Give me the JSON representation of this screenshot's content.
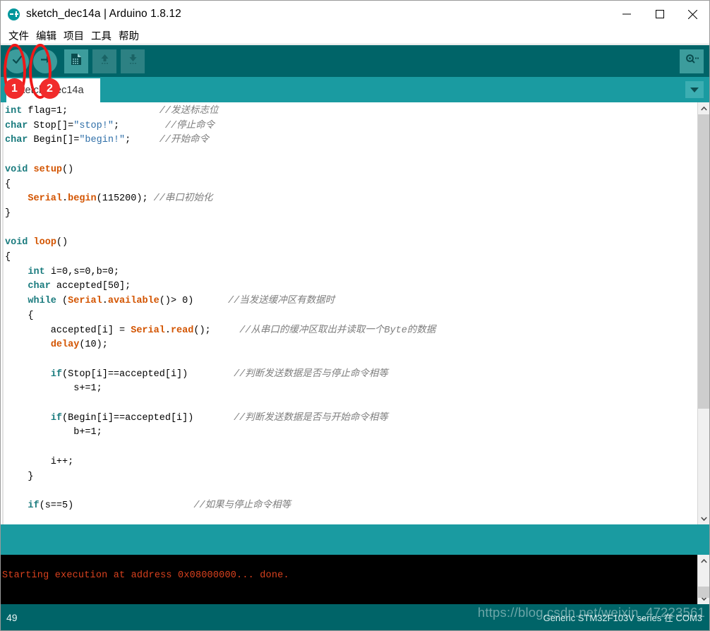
{
  "window": {
    "title": "sketch_dec14a | Arduino 1.8.12",
    "logo_icon": "arduino-logo-icon",
    "minimize_icon": "minimize-icon",
    "maximize_icon": "maximize-icon",
    "close_icon": "close-icon"
  },
  "menubar": {
    "items": [
      {
        "label": "文件",
        "name": "menu-file"
      },
      {
        "label": "编辑",
        "name": "menu-edit"
      },
      {
        "label": "项目",
        "name": "menu-sketch"
      },
      {
        "label": "工具",
        "name": "menu-tools"
      },
      {
        "label": "帮助",
        "name": "menu-help"
      }
    ]
  },
  "toolbar": {
    "verify_icon": "checkmark-icon",
    "upload_icon": "arrow-right-icon",
    "new_icon": "new-document-icon",
    "open_icon": "arrow-up-icon",
    "save_icon": "arrow-down-icon",
    "serial_monitor_icon": "magnifier-icon",
    "background_color": "#006468"
  },
  "tabbar": {
    "active_tab_label": "sketch_dec14a",
    "menu_icon": "chevron-down-icon",
    "background_color": "#1a9ba1"
  },
  "editor": {
    "lines": [
      {
        "segments": [
          {
            "t": "int",
            "c": "kw"
          },
          {
            "t": " flag=1;",
            "c": "id"
          },
          {
            "t": "                ",
            "c": "id"
          },
          {
            "t": "//发送标志位",
            "c": "cmt"
          }
        ]
      },
      {
        "segments": [
          {
            "t": "char",
            "c": "kw"
          },
          {
            "t": " Stop[]=",
            "c": "id"
          },
          {
            "t": "\"stop!\"",
            "c": "lit"
          },
          {
            "t": ";",
            "c": "id"
          },
          {
            "t": "        ",
            "c": "id"
          },
          {
            "t": "//停止命令",
            "c": "cmt"
          }
        ]
      },
      {
        "segments": [
          {
            "t": "char",
            "c": "kw"
          },
          {
            "t": " Begin[]=",
            "c": "id"
          },
          {
            "t": "\"begin!\"",
            "c": "lit"
          },
          {
            "t": ";",
            "c": "id"
          },
          {
            "t": "     ",
            "c": "id"
          },
          {
            "t": "//开始命令",
            "c": "cmt"
          }
        ]
      },
      {
        "segments": [
          {
            "t": "",
            "c": "id"
          }
        ]
      },
      {
        "segments": [
          {
            "t": "void",
            "c": "kw"
          },
          {
            "t": " ",
            "c": "id"
          },
          {
            "t": "setup",
            "c": "setupfn"
          },
          {
            "t": "()",
            "c": "id"
          }
        ]
      },
      {
        "segments": [
          {
            "t": "{",
            "c": "id"
          }
        ]
      },
      {
        "segments": [
          {
            "t": "    ",
            "c": "id"
          },
          {
            "t": "Serial",
            "c": "fn"
          },
          {
            "t": ".",
            "c": "id"
          },
          {
            "t": "begin",
            "c": "fn"
          },
          {
            "t": "(115200); ",
            "c": "id"
          },
          {
            "t": "//串口初始化",
            "c": "cmt"
          }
        ]
      },
      {
        "segments": [
          {
            "t": "}",
            "c": "id"
          }
        ]
      },
      {
        "segments": [
          {
            "t": "",
            "c": "id"
          }
        ]
      },
      {
        "segments": [
          {
            "t": "void",
            "c": "kw"
          },
          {
            "t": " ",
            "c": "id"
          },
          {
            "t": "loop",
            "c": "setupfn"
          },
          {
            "t": "()",
            "c": "id"
          }
        ]
      },
      {
        "segments": [
          {
            "t": "{",
            "c": "id"
          }
        ]
      },
      {
        "segments": [
          {
            "t": "    ",
            "c": "id"
          },
          {
            "t": "int",
            "c": "kw"
          },
          {
            "t": " i=0,s=0,b=0;",
            "c": "id"
          }
        ]
      },
      {
        "segments": [
          {
            "t": "    ",
            "c": "id"
          },
          {
            "t": "char",
            "c": "kw"
          },
          {
            "t": " accepted[50];",
            "c": "id"
          }
        ]
      },
      {
        "segments": [
          {
            "t": "    ",
            "c": "id"
          },
          {
            "t": "while",
            "c": "kw"
          },
          {
            "t": " (",
            "c": "id"
          },
          {
            "t": "Serial",
            "c": "fn"
          },
          {
            "t": ".",
            "c": "id"
          },
          {
            "t": "available",
            "c": "fn"
          },
          {
            "t": "()> 0)",
            "c": "id"
          },
          {
            "t": "      ",
            "c": "id"
          },
          {
            "t": "//当发送缓冲区有数据时",
            "c": "cmt"
          }
        ]
      },
      {
        "segments": [
          {
            "t": "    {",
            "c": "id"
          }
        ]
      },
      {
        "segments": [
          {
            "t": "        accepted[i] = ",
            "c": "id"
          },
          {
            "t": "Serial",
            "c": "fn"
          },
          {
            "t": ".",
            "c": "id"
          },
          {
            "t": "read",
            "c": "fn"
          },
          {
            "t": "();",
            "c": "id"
          },
          {
            "t": "     ",
            "c": "id"
          },
          {
            "t": "//从串口的缓冲区取出并读取一个Byte的数据",
            "c": "cmt"
          }
        ]
      },
      {
        "segments": [
          {
            "t": "        ",
            "c": "id"
          },
          {
            "t": "delay",
            "c": "fn"
          },
          {
            "t": "(10);",
            "c": "id"
          }
        ]
      },
      {
        "segments": [
          {
            "t": "",
            "c": "id"
          }
        ]
      },
      {
        "segments": [
          {
            "t": "        ",
            "c": "id"
          },
          {
            "t": "if",
            "c": "kw2"
          },
          {
            "t": "(Stop[i]==accepted[i])",
            "c": "id"
          },
          {
            "t": "        ",
            "c": "id"
          },
          {
            "t": "//判断发送数据是否与停止命令相等",
            "c": "cmt"
          }
        ]
      },
      {
        "segments": [
          {
            "t": "            s+=1;",
            "c": "id"
          }
        ]
      },
      {
        "segments": [
          {
            "t": "",
            "c": "id"
          }
        ]
      },
      {
        "segments": [
          {
            "t": "        ",
            "c": "id"
          },
          {
            "t": "if",
            "c": "kw2"
          },
          {
            "t": "(Begin[i]==accepted[i])",
            "c": "id"
          },
          {
            "t": "       ",
            "c": "id"
          },
          {
            "t": "//判断发送数据是否与开始命令相等",
            "c": "cmt"
          }
        ]
      },
      {
        "segments": [
          {
            "t": "            b+=1;",
            "c": "id"
          }
        ]
      },
      {
        "segments": [
          {
            "t": "",
            "c": "id"
          }
        ]
      },
      {
        "segments": [
          {
            "t": "        i++;",
            "c": "id"
          }
        ]
      },
      {
        "segments": [
          {
            "t": "    }",
            "c": "id"
          }
        ]
      },
      {
        "segments": [
          {
            "t": "",
            "c": "id"
          }
        ]
      },
      {
        "segments": [
          {
            "t": "    ",
            "c": "id"
          },
          {
            "t": "if",
            "c": "kw2"
          },
          {
            "t": "(s==5)",
            "c": "id"
          },
          {
            "t": "                     ",
            "c": "id"
          },
          {
            "t": "//如果与停止命令相等",
            "c": "cmt"
          }
        ]
      }
    ],
    "scrollbar": {
      "up_icon": "chevron-up-icon",
      "down_icon": "chevron-down-icon",
      "thumb_top_pct": 0,
      "thumb_height_pct": 74
    }
  },
  "console": {
    "message": "Starting execution at address 0x08000000... done.",
    "text_color": "#d9411e",
    "background_color": "#000000",
    "scrollbar": {
      "up_icon": "chevron-up-icon",
      "down_icon": "chevron-down-icon"
    }
  },
  "statusbar": {
    "line_number": "49",
    "board_info": "Generic STM32F103V series 在 COM3",
    "background_color": "#006468"
  },
  "watermark": {
    "text": "https://blog.csdn.net/weixin_47223561"
  },
  "annotations": [
    {
      "badge": "1",
      "name": "annotation-1-verify-button"
    },
    {
      "badge": "2",
      "name": "annotation-2-upload-button"
    }
  ]
}
